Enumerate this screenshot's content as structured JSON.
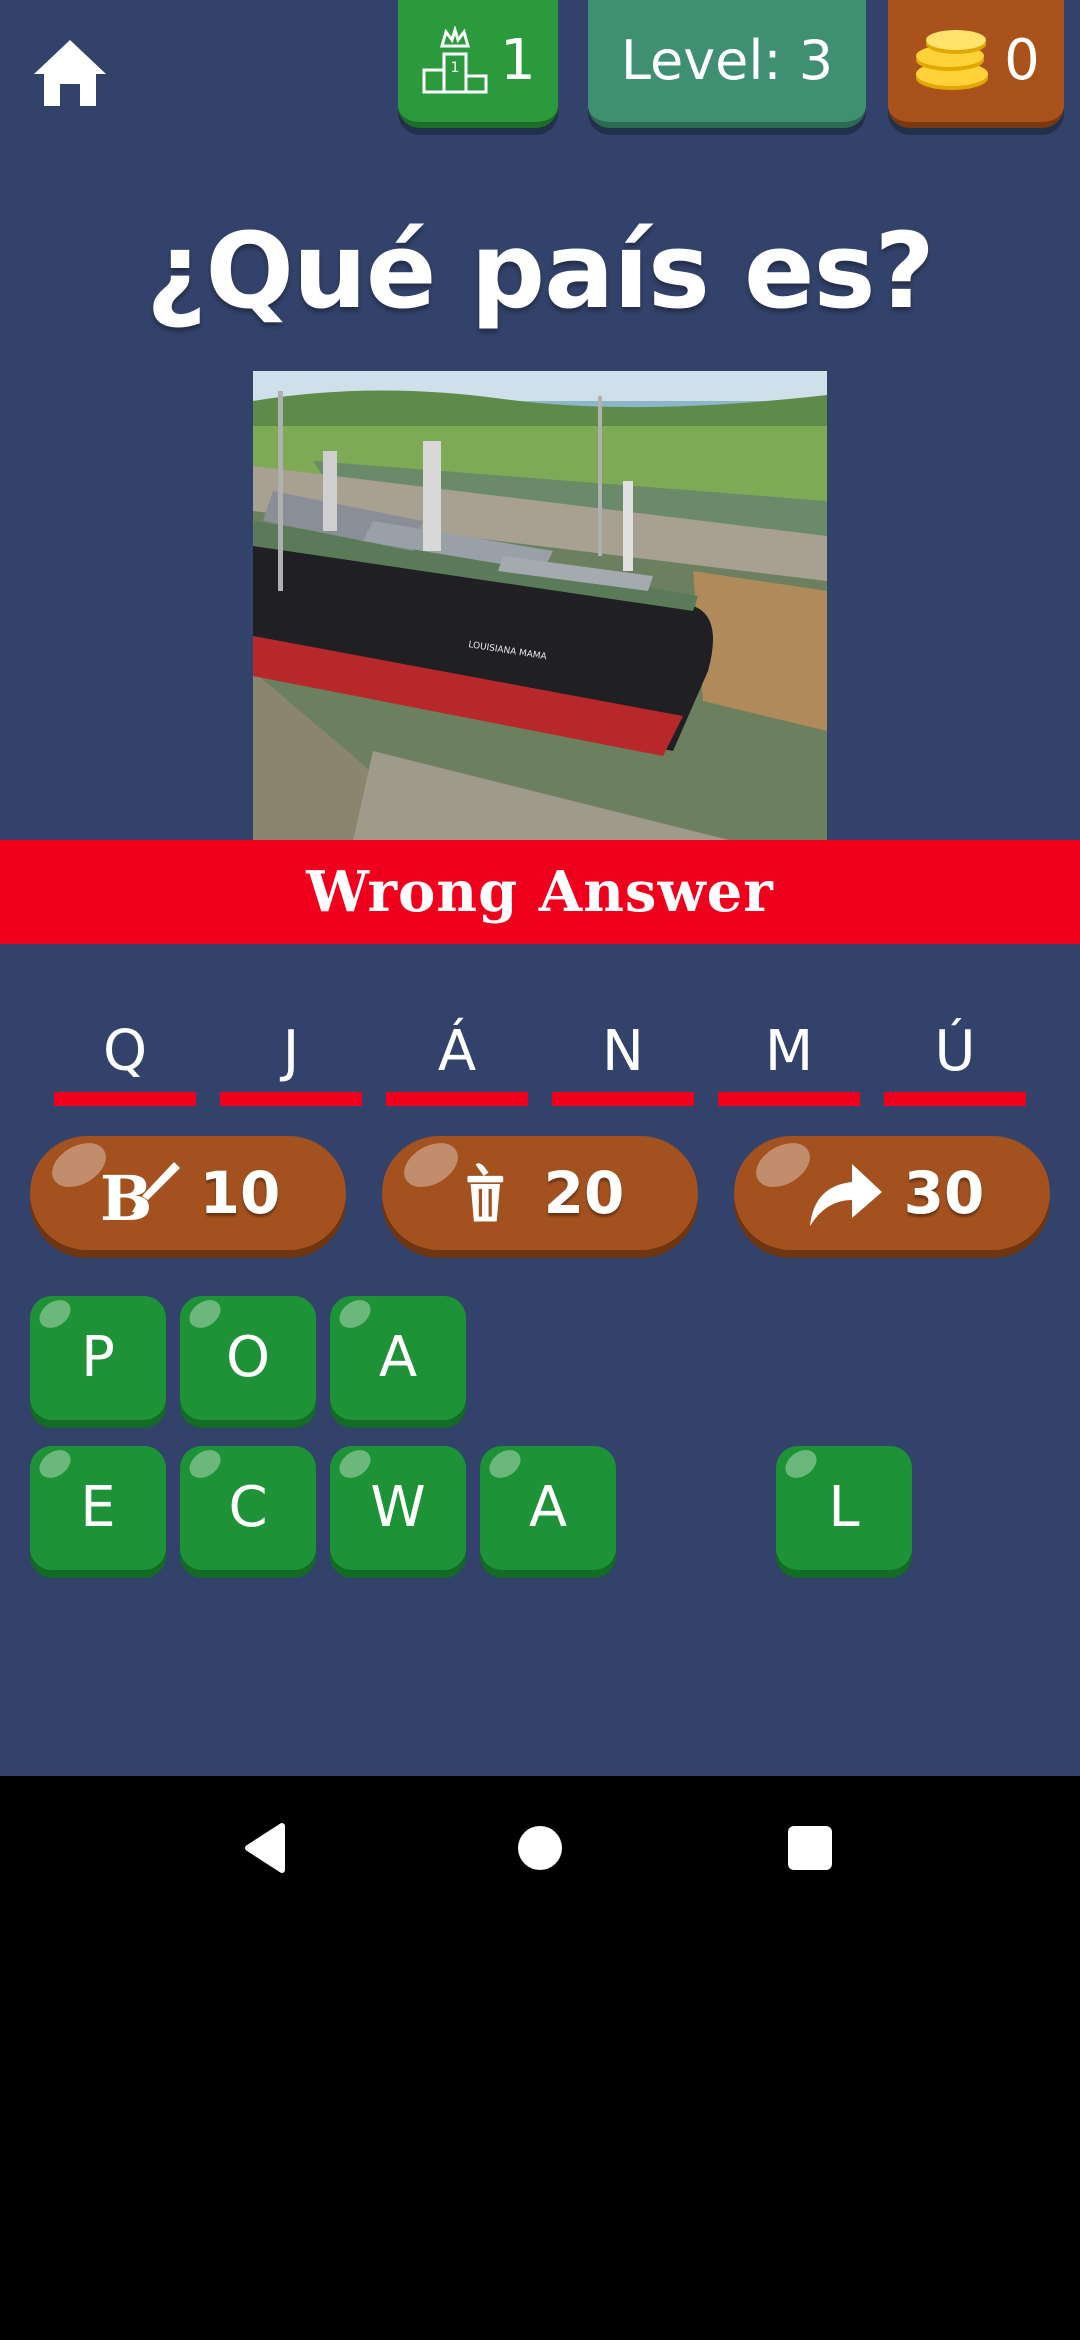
{
  "top_bar": {
    "trophy_count": "1",
    "level_label": "Level: 3",
    "coins": "0"
  },
  "title": "¿Qué país es?",
  "photo": {
    "ship_name": "LOUISIANA MAMA"
  },
  "banner": "Wrong Answer",
  "answer_slots": [
    "Q",
    "J",
    "Á",
    "N",
    "M",
    "Ú"
  ],
  "powerups": [
    {
      "icon": "paintbrush-letter-icon",
      "cost": "10"
    },
    {
      "icon": "trash-icon",
      "cost": "20"
    },
    {
      "icon": "skip-arrow-icon",
      "cost": "30"
    }
  ],
  "letter_tiles": {
    "row1": [
      "P",
      "O",
      "A"
    ],
    "row2": [
      "E",
      "C",
      "W",
      "A",
      "L"
    ]
  },
  "colors": {
    "background": "#33426a",
    "banner": "#f0001d",
    "tile": "#1e9236",
    "powerup": "#a2511f"
  }
}
